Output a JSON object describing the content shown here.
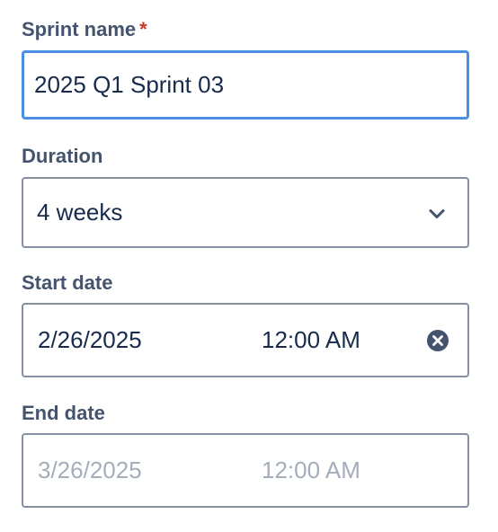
{
  "sprint_name": {
    "label": "Sprint name",
    "required_mark": "*",
    "value": "2025 Q1 Sprint 03"
  },
  "duration": {
    "label": "Duration",
    "selected": "4 weeks"
  },
  "start_date": {
    "label": "Start date",
    "date": "2/26/2025",
    "time": "12:00 AM"
  },
  "end_date": {
    "label": "End date",
    "date": "3/26/2025",
    "time": "12:00 AM"
  },
  "icons": {
    "duration_dropdown": "chevron-down-icon",
    "start_clear": "clear-icon"
  },
  "colors": {
    "label": "#44546f",
    "required": "#c9372c",
    "focus_border": "#4a8fe2",
    "border": "#8590a2",
    "disabled_text": "#a5adba"
  }
}
